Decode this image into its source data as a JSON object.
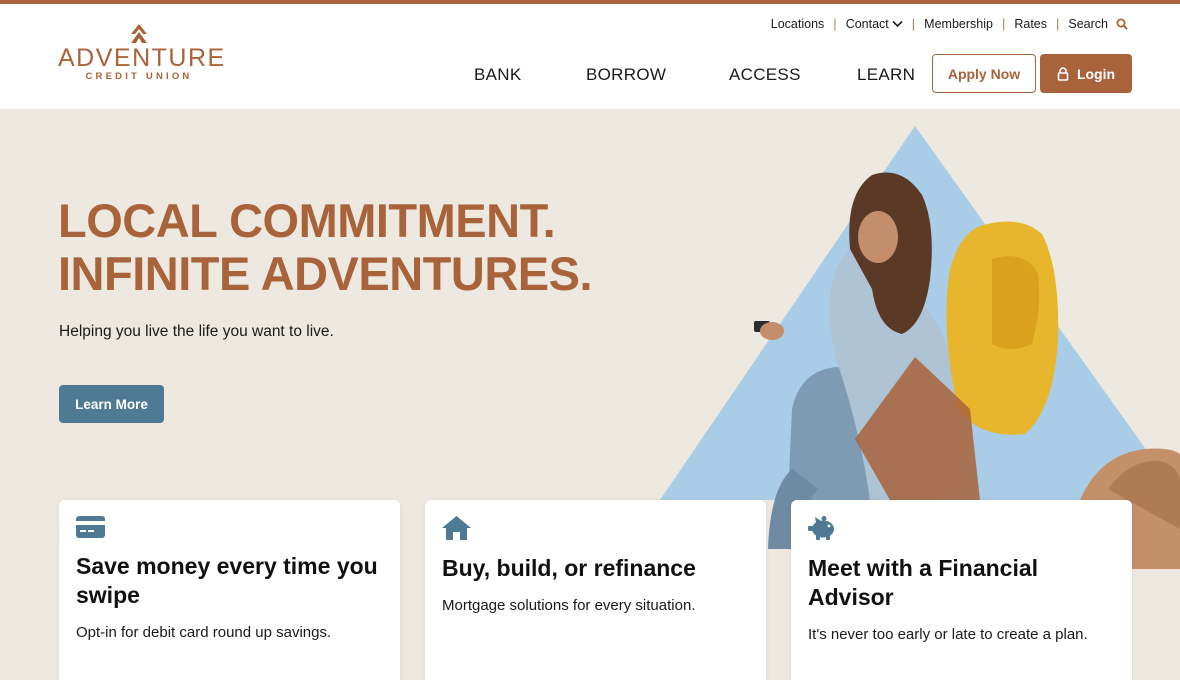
{
  "brand": {
    "name": "ADVENTURE",
    "tagline": "CREDIT UNION",
    "accent_color": "#a8633a",
    "secondary_color": "#4e7a94"
  },
  "utility_nav": [
    {
      "label": "Locations"
    },
    {
      "label": "Contact",
      "icon": "chevron-down-icon"
    },
    {
      "label": "Membership"
    },
    {
      "label": "Rates"
    },
    {
      "label": "Search",
      "icon": "search-icon"
    }
  ],
  "main_nav": [
    {
      "label": "BANK"
    },
    {
      "label": "BORROW"
    },
    {
      "label": "ACCESS"
    },
    {
      "label": "LEARN"
    }
  ],
  "header_buttons": {
    "apply_label": "Apply Now",
    "login_label": "Login",
    "login_icon": "lock-icon"
  },
  "hero": {
    "title_line1": "LOCAL COMMITMENT.",
    "title_line2": "INFINITE ADVENTURES.",
    "subtitle": "Helping you live the life you want to live.",
    "cta_label": "Learn More"
  },
  "cards": [
    {
      "icon": "credit-card-icon",
      "title": "Save money every time you swipe",
      "text": "Opt-in for debit card round up savings."
    },
    {
      "icon": "house-icon",
      "title": "Buy, build, or refinance",
      "text": "Mortgage solutions for every situation."
    },
    {
      "icon": "piggy-bank-icon",
      "title": "Meet with a Financial Advisor",
      "text": "It's never too early or late to create a plan."
    }
  ]
}
